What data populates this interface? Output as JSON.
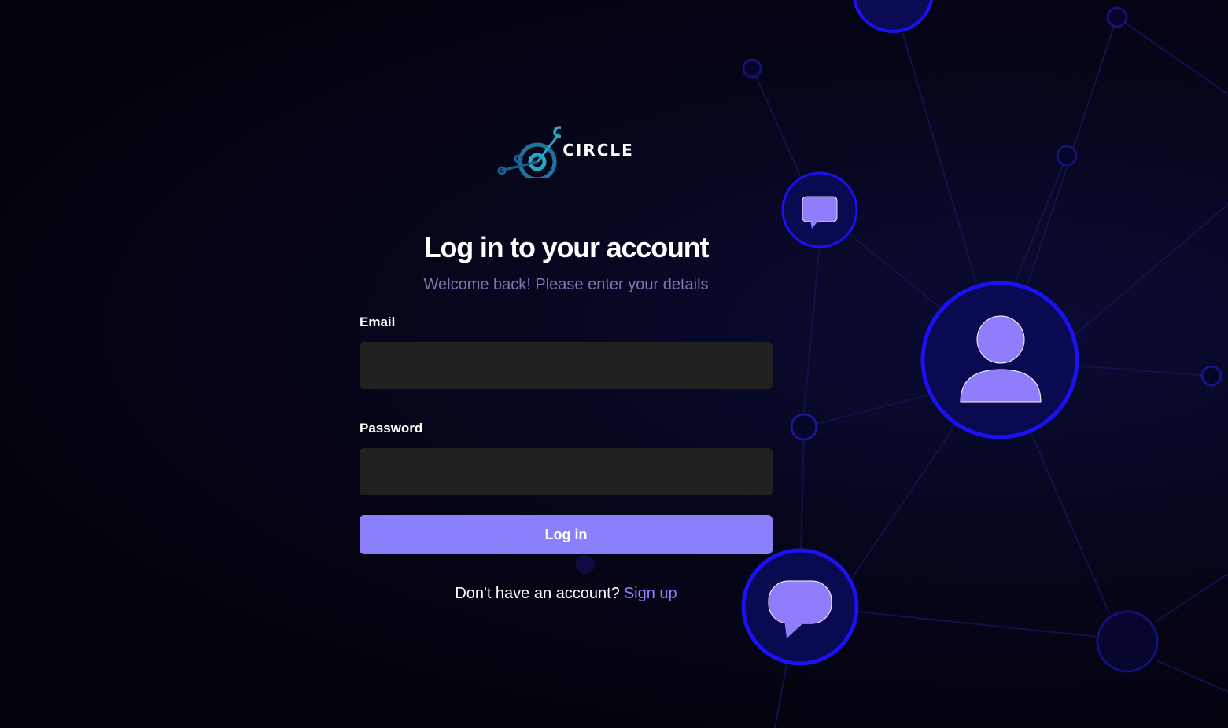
{
  "brand": {
    "name": "CIRCLE",
    "logo_icon": "orbit-logo-icon",
    "logo_colors": [
      "#1b5f8f",
      "#2aa7c2"
    ]
  },
  "login": {
    "title": "Log in to your account",
    "subtitle": "Welcome back! Please enter your details",
    "email_label": "Email",
    "email_value": "",
    "email_placeholder": "",
    "password_label": "Password",
    "password_value": "",
    "password_placeholder": "",
    "submit_label": "Log in",
    "signup_prompt": "Don't have an account?",
    "signup_link": "Sign up"
  },
  "background": {
    "icons": [
      "chat-bubble-icon",
      "user-icon",
      "chat-bubble-icon"
    ]
  },
  "colors": {
    "page_background": "#03030d",
    "accent": "#8b80fb",
    "link": "#8f84ff",
    "subtitle": "#7a77b4",
    "input_background": "#212121",
    "network_ring": "#1a12f0",
    "network_node": "#110f78",
    "icon_fill": "#8f7dfb"
  }
}
